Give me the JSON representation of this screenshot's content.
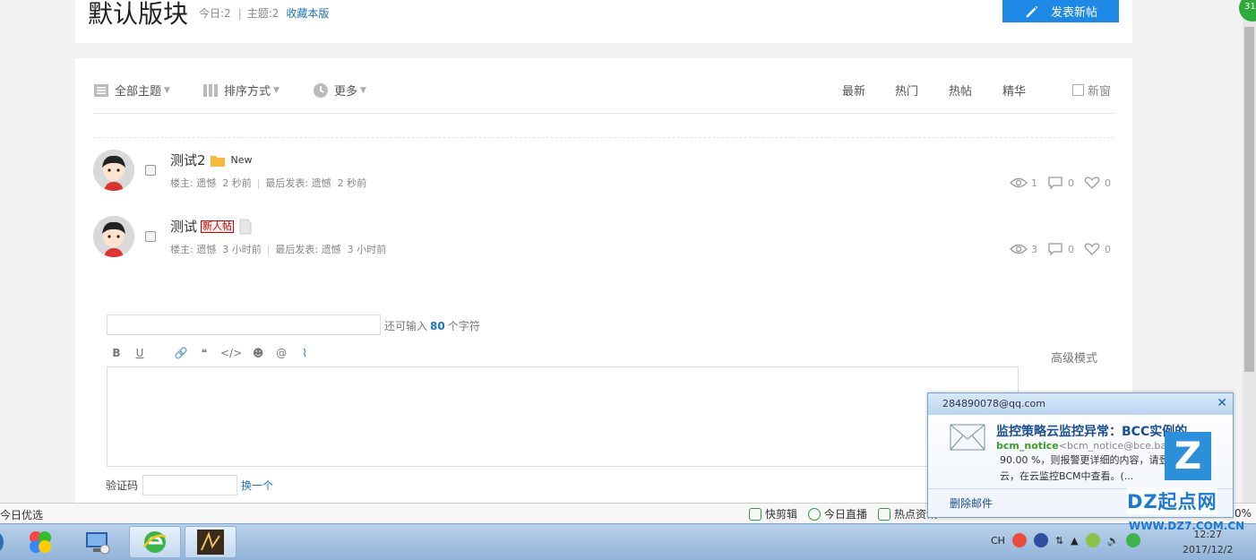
{
  "header": {
    "title": "默认版块",
    "today_label": "今日:2",
    "topics_label": "主题:2",
    "collect_link": "收藏本版",
    "post_button": "发表新帖"
  },
  "filter": {
    "all_topics": "全部主题",
    "sort": "排序方式",
    "more": "更多",
    "tabs": [
      "最新",
      "热门",
      "热帖",
      "精华"
    ],
    "new_window": "新窗"
  },
  "threads": [
    {
      "title": "测试2",
      "tag": "New",
      "author_line": "楼主: 遗憾",
      "author_time": "2 秒前",
      "last_line": "最后发表: 遗憾",
      "last_time": "2 秒前",
      "views": "1",
      "replies": "0",
      "likes": "0"
    },
    {
      "title": "测试",
      "tag": "新人帖",
      "author_line": "楼主: 遗憾",
      "author_time": "3 小时前",
      "last_line": "最后发表: 遗憾",
      "last_time": "3 小时前",
      "views": "3",
      "replies": "0",
      "likes": "0"
    }
  ],
  "reply": {
    "hint_prefix": "还可输入",
    "hint_count": "80",
    "hint_suffix": "个字符",
    "toolbar": [
      "B",
      "U"
    ],
    "advanced_mode": "高级模式",
    "captcha_label": "验证码",
    "captcha_refresh": "换一个"
  },
  "statusbar": {
    "left": "今日优选",
    "items": [
      "快剪辑",
      "今日直播",
      "热点资讯"
    ],
    "percent": "0%"
  },
  "corner_badge": "31",
  "mail_popup": {
    "account": "284890078@qq.com",
    "subject": "监控策略云监控异常：BCC实例的...",
    "from_name": "bcm_notice",
    "from_addr": "<bcm_notice@bce.baidu.com>",
    "body": "90.00 %，则报警更详细的内容，请登录百度云，在云监控BCM中查看。(...",
    "delete": "删除邮件"
  },
  "taskbar": {
    "tray_lang": "CH",
    "clock_time": "12:27",
    "clock_date": "2017/12/2"
  },
  "watermark": {
    "logo": "Z",
    "name": "DZ起点网",
    "url": "WWW.DZ7.COM.CN"
  },
  "colors": {
    "accent": "#1e88e5",
    "link": "#1e73be",
    "mail_green": "#3a9d23"
  }
}
